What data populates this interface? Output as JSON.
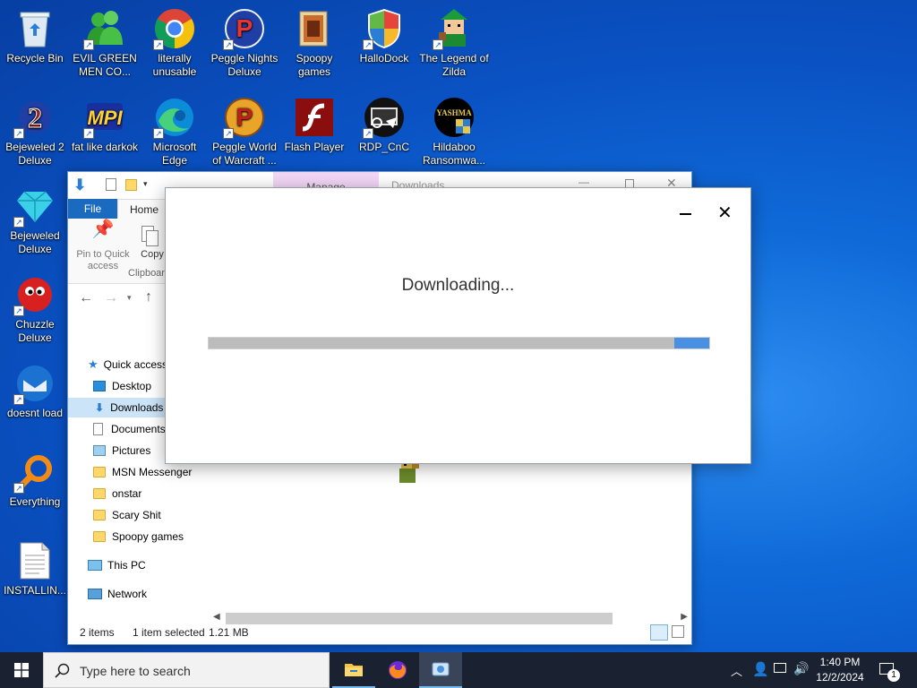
{
  "desktop": {
    "icons": [
      {
        "label": "Recycle Bin",
        "icon": "recycle-bin-icon"
      },
      {
        "label": "EVIL GREEN MEN CO...",
        "icon": "green-men-icon"
      },
      {
        "label": "literally unusable",
        "icon": "chrome-icon"
      },
      {
        "label": "Peggle Nights Deluxe",
        "icon": "peggle-icon"
      },
      {
        "label": "Spoopy games",
        "icon": "folder-icon"
      },
      {
        "label": "HalloDock",
        "icon": "shield-icon"
      },
      {
        "label": "The Legend of Zilda",
        "icon": "zilda-icon"
      },
      {
        "label": "Bejeweled 2 Deluxe",
        "icon": "bejeweled2-icon"
      },
      {
        "label": "fat like darkok",
        "icon": "mpi-icon"
      },
      {
        "label": "Microsoft Edge",
        "icon": "edge-icon"
      },
      {
        "label": "Peggle World of Warcraft ...",
        "icon": "peggle-wow-icon"
      },
      {
        "label": "Flash Player",
        "icon": "flash-icon"
      },
      {
        "label": "RDP_CnC",
        "icon": "rdp-icon"
      },
      {
        "label": "Hildaboo Ransomwa...",
        "icon": "yashma-icon"
      },
      {
        "label": "Bejeweled Deluxe",
        "icon": "gem-icon"
      },
      {
        "label": "Chuzzle Deluxe",
        "icon": "chuzzle-icon"
      },
      {
        "label": "doesnt load",
        "icon": "thunderbird-icon"
      },
      {
        "label": "Everything",
        "icon": "search-icon"
      },
      {
        "label": "INSTALLIN...",
        "icon": "text-file-icon"
      }
    ],
    "yashma_text": "YASHMA"
  },
  "explorer": {
    "title_context_tab": "Manage",
    "title_text": "Downloads",
    "tabs": {
      "file": "File",
      "home": "Home"
    },
    "ribbon": {
      "pin_label": "Pin to Quick access",
      "copy_label": "Copy",
      "group_label": "Clipboard"
    },
    "tree": [
      {
        "label": "Quick access",
        "icon": "star-icon"
      },
      {
        "label": "Desktop",
        "icon": "desktop-icon"
      },
      {
        "label": "Downloads",
        "icon": "download-icon",
        "selected": true
      },
      {
        "label": "Documents",
        "icon": "documents-icon"
      },
      {
        "label": "Pictures",
        "icon": "pictures-icon"
      },
      {
        "label": "MSN Messenger",
        "icon": "folder-icon"
      },
      {
        "label": "onstar",
        "icon": "folder-icon"
      },
      {
        "label": "Scary Shit",
        "icon": "folder-icon"
      },
      {
        "label": "Spoopy games",
        "icon": "folder-icon"
      },
      {
        "label": "This PC",
        "icon": "pc-icon"
      },
      {
        "label": "Network",
        "icon": "network-icon"
      }
    ],
    "status": {
      "items": "2 items",
      "selected": "1 item selected",
      "size": "1.21 MB"
    }
  },
  "dialog": {
    "message": "Downloading...",
    "progress_fraction": 0.07,
    "progress_color": "#4a90e2"
  },
  "taskbar": {
    "search_placeholder": "Type here to search",
    "time": "1:40 PM",
    "date": "12/2/2024",
    "notification_count": "1"
  }
}
